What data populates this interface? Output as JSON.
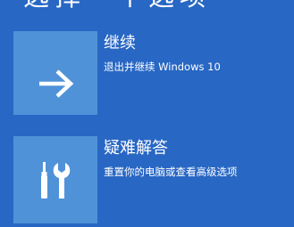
{
  "header": {
    "title": "选择一个选项"
  },
  "options": [
    {
      "title": "继续",
      "description": "退出并继续 Windows 10",
      "icon": "arrow-right-icon"
    },
    {
      "title": "疑难解答",
      "description": "重置你的电脑或查看高级选项",
      "icon": "tools-icon"
    }
  ],
  "colors": {
    "background": "#2867c4",
    "tile": "#4f92d8",
    "text": "#ffffff"
  }
}
